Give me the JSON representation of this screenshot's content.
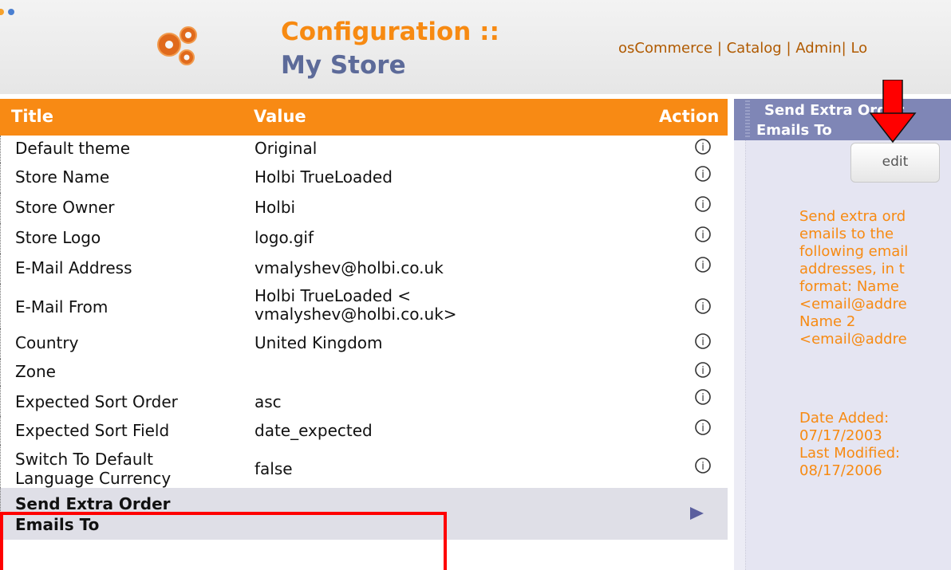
{
  "header": {
    "title_line1": "Configuration ::",
    "title_line2": "My Store",
    "nav": [
      "osCommerce",
      "Catalog",
      "Admin",
      "Lo"
    ],
    "nav_separators": [
      " | ",
      " | ",
      "| "
    ]
  },
  "table": {
    "columns": {
      "title": "Title",
      "value": "Value",
      "action": "Action"
    },
    "rows": [
      {
        "title": "Default theme",
        "value": "Original"
      },
      {
        "title": "Store Name",
        "value": "Holbi TrueLoaded"
      },
      {
        "title": "Store Owner",
        "value": "Holbi"
      },
      {
        "title": "Store Logo",
        "value": "logo.gif"
      },
      {
        "title": "E-Mail Address",
        "value": "vmalyshev@holbi.co.uk"
      },
      {
        "title": "E-Mail From",
        "value_line1": "Holbi TrueLoaded <",
        "value_line2": "vmalyshev@holbi.co.uk>"
      },
      {
        "title": "Country",
        "value": "United Kingdom"
      },
      {
        "title": "Zone",
        "value": ""
      },
      {
        "title": "Expected Sort Order",
        "value": "asc"
      },
      {
        "title": "Expected Sort Field",
        "value": "date_expected"
      },
      {
        "title_line1": "Switch To Default",
        "title_line2": "Language Currency",
        "value": "false"
      }
    ],
    "selected_row": {
      "title_line1": "Send Extra Order",
      "title_line2": "Emails To"
    }
  },
  "panel": {
    "heading_line1": "Send Extra Order",
    "heading_line2": "Emails To",
    "edit_label": "edit",
    "description": "Send extra ord\nemails to the\nfollowing email\naddresses, in t\nformat: Name\n<email@addre\nName 2\n<email@addre",
    "dates": "Date Added:\n07/17/2003\nLast Modified:\n08/17/2006"
  },
  "colors": {
    "accent": "#f88a14",
    "panel_head": "#7f86b6",
    "highlight": "#ff0000"
  }
}
